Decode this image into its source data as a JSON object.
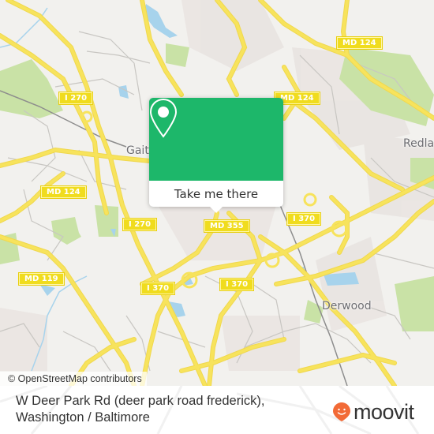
{
  "map": {
    "road_labels": [
      {
        "id": "i270-north",
        "text": "I 270"
      },
      {
        "id": "md124-top",
        "text": "MD 124"
      },
      {
        "id": "md124-mid",
        "text": "MD 124"
      },
      {
        "id": "md124-west",
        "text": "MD 124"
      },
      {
        "id": "i270-south",
        "text": "I 270"
      },
      {
        "id": "md355",
        "text": "MD 355"
      },
      {
        "id": "i370-east",
        "text": "I 370"
      },
      {
        "id": "md119",
        "text": "MD 119"
      },
      {
        "id": "i370-mid",
        "text": "I 370"
      },
      {
        "id": "i370-south",
        "text": "I 370"
      }
    ],
    "places": [
      {
        "id": "gaithersburg",
        "text": "Gaith"
      },
      {
        "id": "redland",
        "text": "Redlan"
      },
      {
        "id": "derwood",
        "text": "Derwood"
      }
    ],
    "colors": {
      "land": "#f2f1ee",
      "park": "#c9e2a6",
      "water": "#a7d3ec",
      "road": "#f7e35c",
      "minor_road": "#c8c6c2",
      "popup_green": "#1db76a"
    }
  },
  "popup": {
    "icon": "location-pin-icon",
    "button_label": "Take me there"
  },
  "attribution": "© OpenStreetMap contributors",
  "footer": {
    "title_line1": "W Deer Park Rd (deer park road frederick),",
    "title_line2": "Washington / Baltimore",
    "logo_text": "moovit",
    "logo_color": "#f26a36"
  }
}
